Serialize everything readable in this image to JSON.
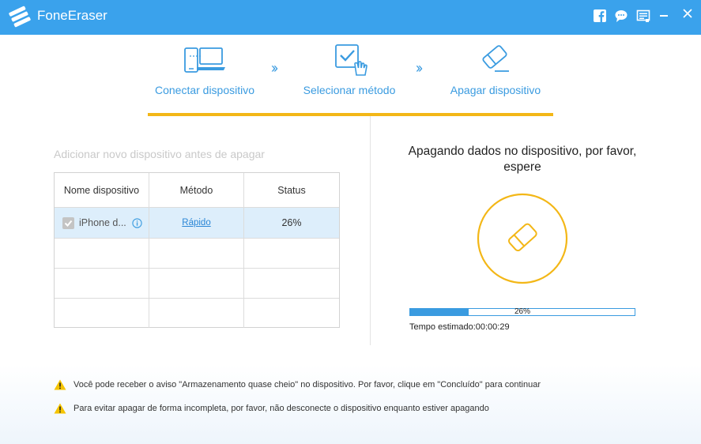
{
  "window": {
    "title": "FoneEraser",
    "accent_color": "#3aa2ec",
    "step_highlight_color": "#f3b717",
    "titlebar_icons": [
      "facebook-icon",
      "chat-icon",
      "menu-icon",
      "minimize-icon",
      "close-icon"
    ]
  },
  "steps": [
    {
      "label": "Conectar dispositivo",
      "icon": "devices-icon"
    },
    {
      "label": "Selecionar método",
      "icon": "select-method-icon"
    },
    {
      "label": "Apagar dispositivo",
      "icon": "eraser-icon"
    }
  ],
  "left": {
    "add_device_text": "Adicionar novo dispositivo antes de apagar",
    "table": {
      "headers": [
        "Nome dispositivo",
        "Método",
        "Status"
      ],
      "rows": [
        {
          "name": "iPhone d...",
          "method": "Rápido",
          "status": "26%",
          "checked": true
        }
      ]
    }
  },
  "right": {
    "message": "Apagando dados no dispositivo, por favor, espere",
    "progress_percent": 26,
    "progress_text": "26%",
    "eta_label": "Tempo estimado:",
    "eta_value": "00:00:29"
  },
  "footer": {
    "warnings": [
      "Você pode receber o aviso \"Armazenamento quase cheio\" no dispositivo. Por favor, clique em \"Concluído\" para continuar",
      "Para evitar apagar de forma incompleta, por favor, não desconecte o dispositivo enquanto estiver apagando"
    ]
  }
}
